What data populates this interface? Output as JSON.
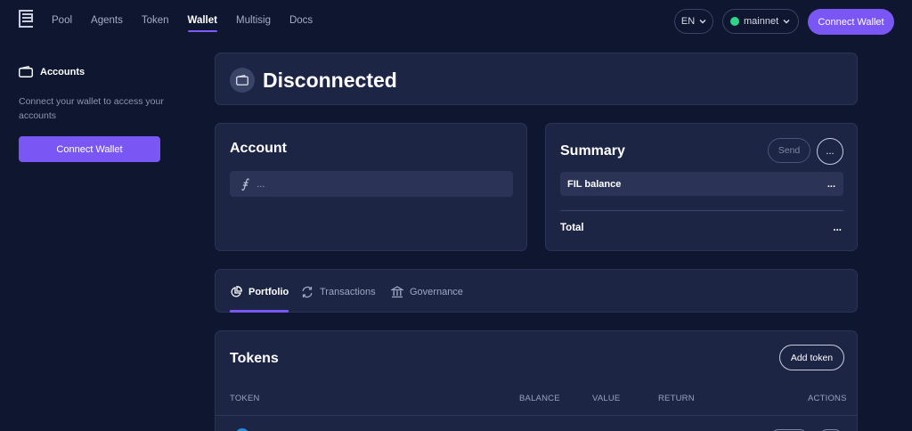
{
  "nav": {
    "items": [
      {
        "label": "Pool",
        "active": false
      },
      {
        "label": "Agents",
        "active": false
      },
      {
        "label": "Token",
        "active": false
      },
      {
        "label": "Wallet",
        "active": true
      },
      {
        "label": "Multisig",
        "active": false
      },
      {
        "label": "Docs",
        "active": false
      }
    ],
    "language": "EN",
    "network": "mainnet",
    "connect_label": "Connect Wallet"
  },
  "sidebar": {
    "accounts_label": "Accounts",
    "description": "Connect your wallet to access your accounts",
    "connect_label": "Connect Wallet"
  },
  "status": {
    "title": "Disconnected"
  },
  "account": {
    "title": "Account",
    "address_symbol": "⨎",
    "address_value": "..."
  },
  "summary": {
    "title": "Summary",
    "send_label": "Send",
    "more_label": "...",
    "fil_balance_label": "FIL balance",
    "fil_balance_value": "...",
    "total_label": "Total",
    "total_value": "..."
  },
  "tabs": [
    {
      "label": "Portfolio",
      "icon": "pie-chart-icon",
      "active": true
    },
    {
      "label": "Transactions",
      "icon": "refresh-icon",
      "active": false
    },
    {
      "label": "Governance",
      "icon": "bank-icon",
      "active": false
    }
  ],
  "tokens": {
    "title": "Tokens",
    "add_label": "Add token",
    "columns": [
      "TOKEN",
      "BALANCE",
      "VALUE",
      "RETURN",
      "ACTIONS"
    ]
  },
  "colors": {
    "accent": "#7a57f5",
    "background": "#0f1630",
    "card": "#1d2545",
    "network_dot": "#2fd38a"
  }
}
